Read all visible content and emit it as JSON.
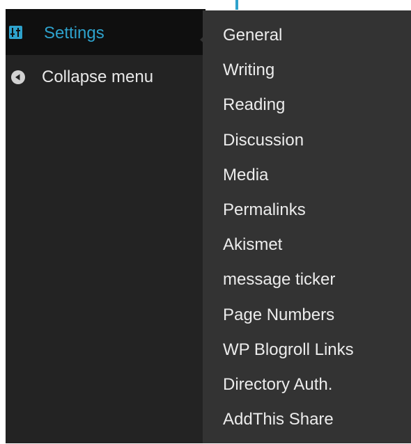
{
  "sidebar": {
    "settings": {
      "label": "Settings",
      "icon": "settings-sliders-icon"
    },
    "collapse": {
      "label": "Collapse menu",
      "icon": "collapse-arrow-icon"
    }
  },
  "submenu": {
    "items": [
      {
        "label": "General"
      },
      {
        "label": "Writing"
      },
      {
        "label": "Reading"
      },
      {
        "label": "Discussion"
      },
      {
        "label": "Media"
      },
      {
        "label": "Permalinks"
      },
      {
        "label": "Akismet"
      },
      {
        "label": "message ticker"
      },
      {
        "label": "Page Numbers"
      },
      {
        "label": "WP Blogroll Links"
      },
      {
        "label": "Directory Auth."
      },
      {
        "label": "AddThis Share"
      }
    ]
  },
  "colors": {
    "accent": "#2ea2cc",
    "sidebar_bg": "#232323",
    "active_bg": "#0f0f0f",
    "submenu_bg": "#333333",
    "text": "#eeeeee"
  }
}
